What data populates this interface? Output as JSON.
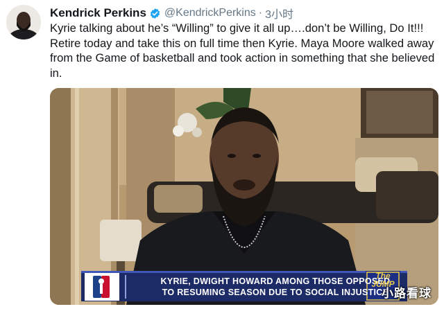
{
  "tweet": {
    "display_name": "Kendrick Perkins",
    "handle": "@KendrickPerkins",
    "separator": "·",
    "time": "3小时",
    "text": "Kyrie talking about he’s “Willing” to give it all up….don’t be Willing, Do It!!! Retire today and take this on full time then Kyrie. Maya Moore walked away from the Game of basketball and took action in something that she believed in."
  },
  "media": {
    "ticker_line1": "KYRIE, DWIGHT HOWARD AMONG THOSE OPPOSED",
    "ticker_line2": "TO RESUMING SEASON DUE TO SOCIAL INJUSTICE",
    "show_logo": "The JUMP",
    "watermark": "小路看球"
  },
  "colors": {
    "verified": "#1da1f2",
    "handle": "#657786",
    "ticker_bg": "#1c2a66"
  }
}
